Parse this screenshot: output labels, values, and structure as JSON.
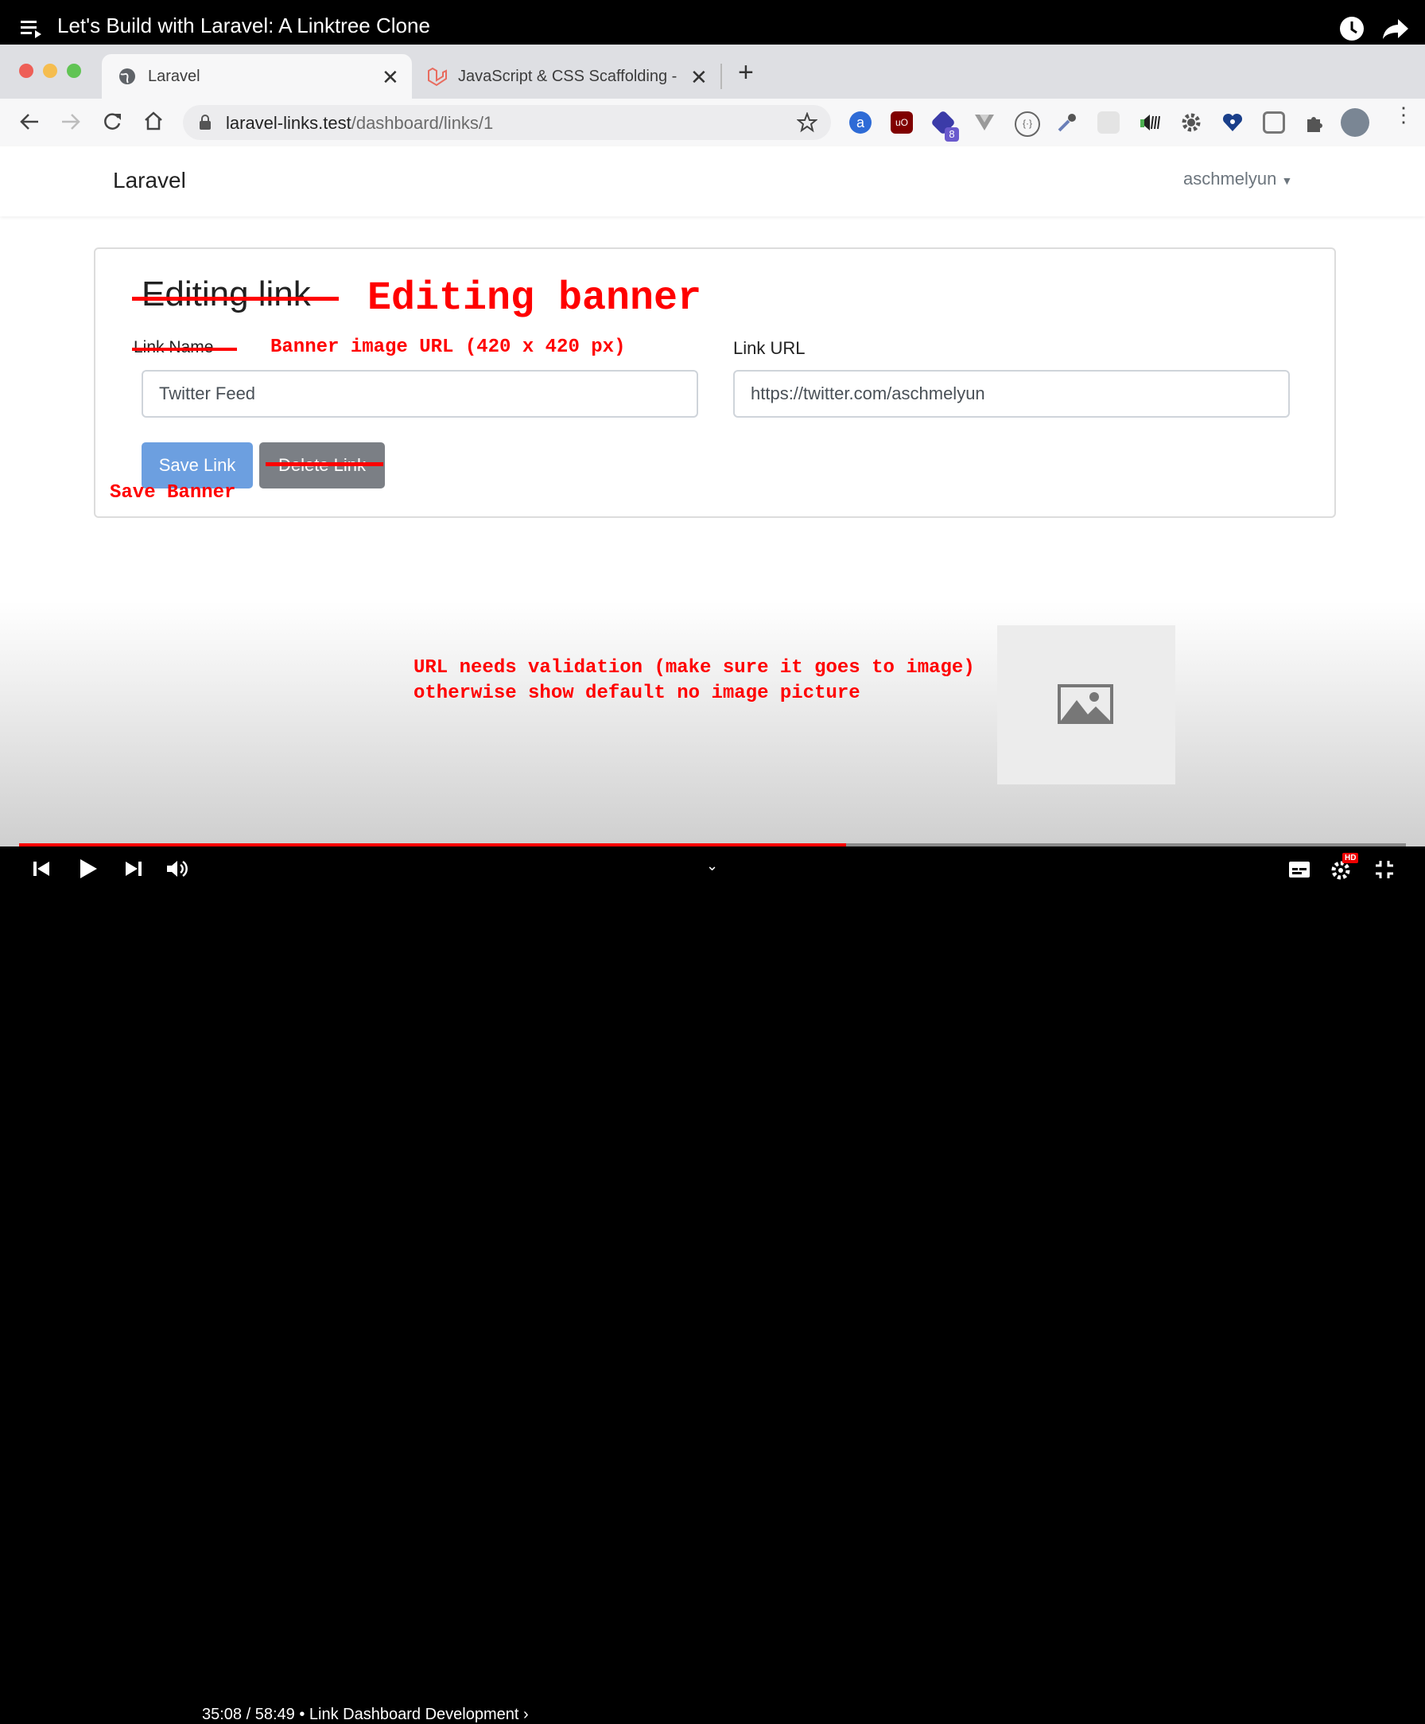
{
  "video": {
    "title": "Let's Build with Laravel: A Linktree Clone",
    "time_current": "35:08",
    "time_total": "58:49",
    "chapter": "Link Dashboard Development",
    "progress": 0.596,
    "quality_badge": "HD"
  },
  "browser": {
    "tabs": [
      {
        "label": "Laravel",
        "active": true
      },
      {
        "label": "JavaScript & CSS Scaffolding -",
        "active": false
      }
    ],
    "url_host": "laravel-links.test",
    "url_path": "/dashboard/links/1",
    "extension_badge": "8"
  },
  "page": {
    "brand": "Laravel",
    "user": "aschmelyun",
    "heading": "Editing link",
    "link_name_label": "Link Name",
    "link_url_label": "Link URL",
    "link_name_value": "Twitter Feed",
    "link_url_value": "https://twitter.com/aschmelyun",
    "save_button": "Save Link",
    "delete_button": "Delete Link"
  },
  "annotations": {
    "heading": "Editing banner",
    "banner_label": "Banner image URL (420 x 420 px)",
    "save": "Save Banner",
    "validation_line1": "URL needs validation (make sure it goes to image)",
    "validation_line2": "otherwise show default no image picture"
  },
  "colors": {
    "annotation": "#ff0000",
    "primary_button": "#6c9fe0",
    "secondary_button": "#7b7f85",
    "progress": "#ff0000"
  }
}
